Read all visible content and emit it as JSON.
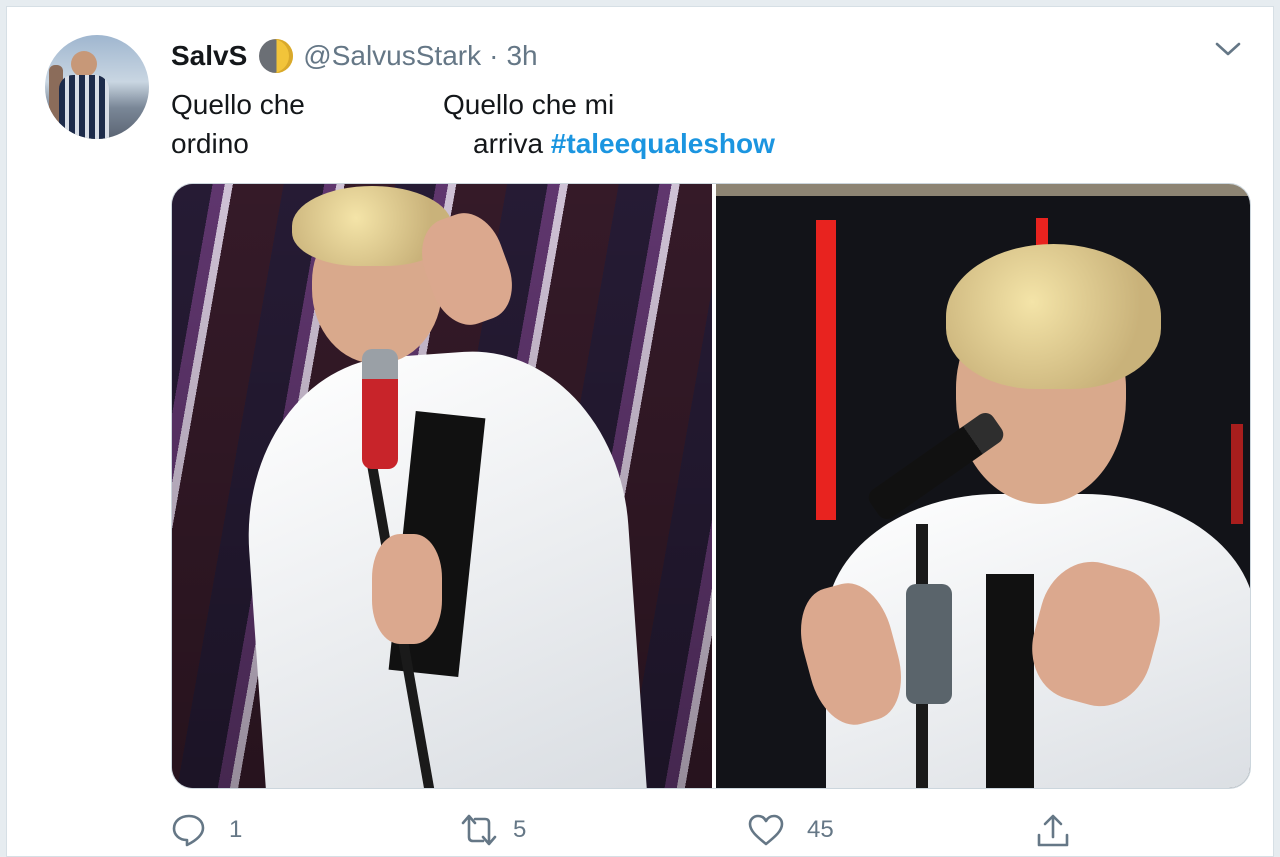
{
  "tweet": {
    "display_name": "SalvS",
    "handle": "@SalvusStark",
    "separator": "·",
    "time": "3h",
    "text": {
      "left_line1": "Quello che",
      "left_line2": "ordino",
      "right_line1": "Quello che mi",
      "right_line2": "arriva",
      "hashtag": "#taleequaleshow"
    },
    "media": [
      {
        "alt": "photo-left"
      },
      {
        "alt": "photo-right"
      }
    ],
    "actions": {
      "reply_count": "1",
      "retweet_count": "5",
      "like_count": "45"
    }
  },
  "colors": {
    "hashtag": "#1b95e0",
    "meta": "#657786",
    "background": "#e6ecf0"
  },
  "icons": [
    "moon-emoji-icon",
    "chevron-down-icon",
    "reply-icon",
    "retweet-icon",
    "like-icon",
    "share-icon"
  ]
}
